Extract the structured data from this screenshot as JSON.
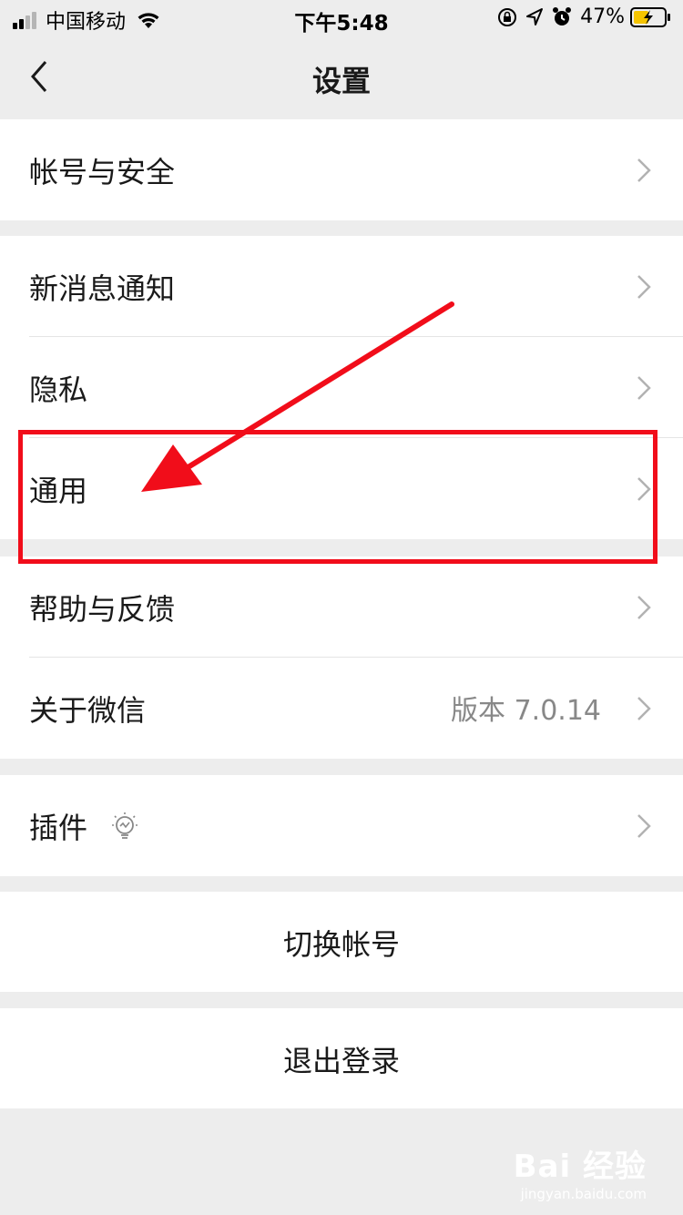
{
  "status_bar": {
    "carrier": "中国移动",
    "time": "下午5:48",
    "battery": "47%"
  },
  "nav": {
    "title": "设置"
  },
  "groups": [
    {
      "items": [
        {
          "label": "帐号与安全"
        }
      ]
    },
    {
      "items": [
        {
          "label": "新消息通知"
        },
        {
          "label": "隐私"
        },
        {
          "label": "通用"
        }
      ]
    },
    {
      "items": [
        {
          "label": "帮助与反馈"
        },
        {
          "label": "关于微信",
          "value": "版本 7.0.14"
        }
      ]
    },
    {
      "items": [
        {
          "label": "插件",
          "icon": "bulb-icon"
        }
      ]
    }
  ],
  "actions": {
    "switch_account": "切换帐号",
    "logout": "退出登录"
  },
  "annotation": {
    "color": "#f10d1a"
  },
  "watermark": {
    "logo": "Bai 经验",
    "url": "jingyan.baidu.com"
  }
}
